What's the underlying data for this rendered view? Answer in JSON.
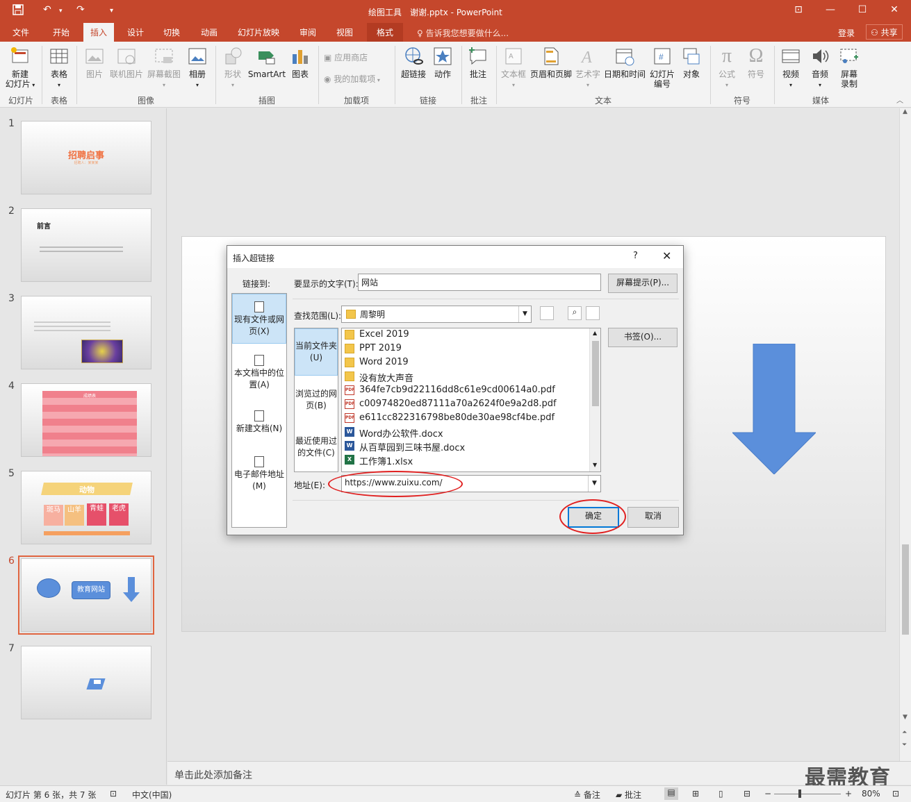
{
  "titlebar": {
    "tool_context": "绘图工具",
    "doc_title": "谢谢.pptx - PowerPoint",
    "undo": "↶",
    "redo": "↷",
    "save_icon": "save-icon",
    "minimize": "—",
    "maximize": "☐",
    "close": "✕",
    "restore": "⊡"
  },
  "tabs": [
    "文件",
    "开始",
    "插入",
    "设计",
    "切换",
    "动画",
    "幻灯片放映",
    "审阅",
    "视图",
    "格式"
  ],
  "active_tab": "插入",
  "tell_me": "告诉我您想要做什么...",
  "login": "登录",
  "share": "共享",
  "ribbon": {
    "new_slide": "新建\n幻灯片",
    "table": "表格",
    "picture": "图片",
    "online_picture": "联机图片",
    "screenshot": "屏幕截图",
    "album": "相册",
    "shapes": "形状",
    "smartart": "SmartArt",
    "chart": "图表",
    "store": "应用商店",
    "my_addins": "我的加载项",
    "hyperlink": "超链接",
    "action": "动作",
    "comment": "批注",
    "textbox": "文本框",
    "header_footer": "页眉和页脚",
    "wordart": "艺术字",
    "datetime": "日期和时间",
    "slide_number": "幻灯片\n编号",
    "object": "对象",
    "equation": "公式",
    "symbol": "符号",
    "video": "视频",
    "audio": "音频",
    "screen_record": "屏幕\n录制",
    "groups": [
      "幻灯片",
      "表格",
      "图像",
      "插图",
      "加载项",
      "链接",
      "批注",
      "文本",
      "符号",
      "媒体"
    ]
  },
  "thumbnails": {
    "numbers": [
      "1",
      "2",
      "3",
      "4",
      "5",
      "6",
      "7"
    ],
    "slide1_title": "招聘启事",
    "slide1_sub": "招聘人：某某某",
    "slide2_title": "前言",
    "slide4_title": "成绩表",
    "slide5_title": "动物",
    "slide5_cells": [
      "斑马",
      "山羊",
      "青蛙",
      "老虎"
    ],
    "slide6_box": "教育网站"
  },
  "notes_placeholder": "单击此处添加备注",
  "watermark": "最需教育",
  "status": {
    "slide_info": "幻灯片 第 6 张，共 7 张",
    "lang": "中文(中国)",
    "notes": "备注",
    "comments": "批注",
    "zoom": "80%",
    "zoom_level": 0.8
  },
  "dialog": {
    "title": "插入超链接",
    "help": "?",
    "close": "✕",
    "link_to": "链接到:",
    "display_text_label": "要显示的文字(T):",
    "display_text_value": "网站",
    "screentip_btn": "屏幕提示(P)...",
    "look_in_label": "查找范围(L):",
    "look_in_value": "周黎明",
    "bookmark_btn": "书签(O)...",
    "address_label": "地址(E):",
    "address_value": "https://www.zuixu.com/",
    "ok": "确定",
    "cancel": "取消",
    "link_types": [
      {
        "label": "现有文件或网页(X)",
        "selected": true
      },
      {
        "label": "本文档中的位置(A)",
        "selected": false
      },
      {
        "label": "新建文档(N)",
        "selected": false
      },
      {
        "label": "电子邮件地址(M)",
        "selected": false
      }
    ],
    "browse_sections": [
      {
        "label": "当前文件夹(U)",
        "selected": true
      },
      {
        "label": "浏览过的网页(B)",
        "selected": false
      },
      {
        "label": "最近使用过的文件(C)",
        "selected": false
      }
    ],
    "files": [
      {
        "name": "Excel 2019",
        "type": "folder"
      },
      {
        "name": "PPT 2019",
        "type": "folder"
      },
      {
        "name": "Word 2019",
        "type": "folder"
      },
      {
        "name": "没有放大声音",
        "type": "folder"
      },
      {
        "name": "364fe7cb9d22116dd8c61e9cd00614a0.pdf",
        "type": "pdf"
      },
      {
        "name": "c00974820ed87111a70a2624f0e9a2d8.pdf",
        "type": "pdf"
      },
      {
        "name": "e611cc822316798be80de30ae98cf4be.pdf",
        "type": "pdf"
      },
      {
        "name": "Word办公软件.docx",
        "type": "docx"
      },
      {
        "name": "从百草园到三味书屋.docx",
        "type": "docx"
      },
      {
        "name": "工作簿1.xlsx",
        "type": "xlsx"
      }
    ]
  },
  "colors": {
    "accent": "#c5472c",
    "slide_shape": "#5b8fdb",
    "highlight": "#e02020"
  }
}
